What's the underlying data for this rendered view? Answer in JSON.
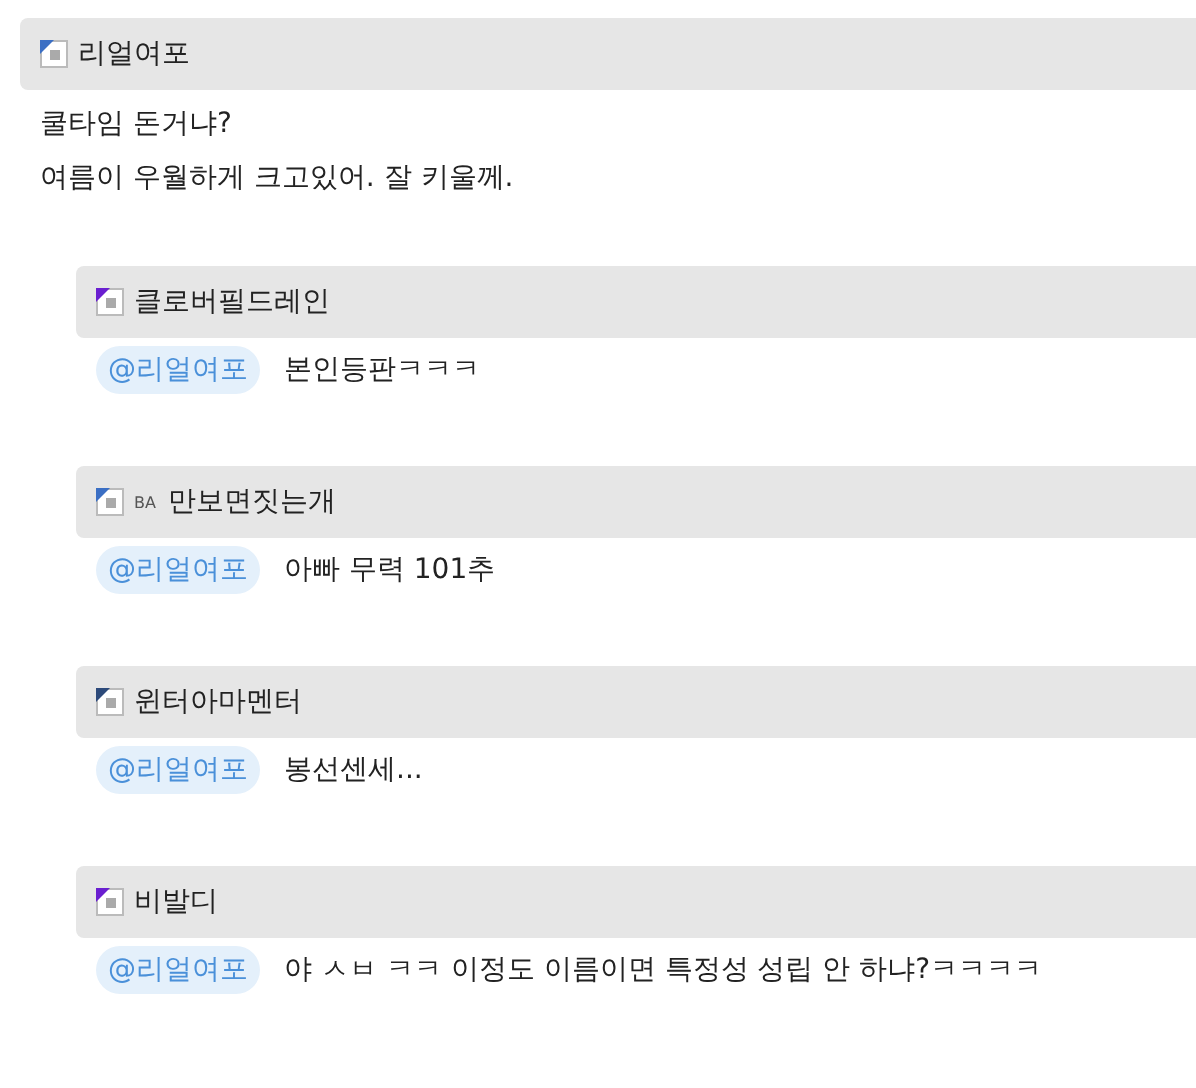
{
  "post": {
    "author": {
      "name": "리얼여포",
      "color": "#3b6fc4"
    },
    "lines": [
      "쿨타임 돈거냐?",
      "여름이 우월하게 크고있어. 잘 키울께."
    ]
  },
  "replies": [
    {
      "author": {
        "name": "클로버필드레인",
        "color": "#6a1fd0"
      },
      "mention": "@리얼여포",
      "text": "본인등판ㅋㅋㅋ"
    },
    {
      "author": {
        "name": "만보면짓는개",
        "prefix": "BA",
        "color": "#3b6fc4"
      },
      "mention": "@리얼여포",
      "text": "아빠 무력 101추"
    },
    {
      "author": {
        "name": "윈터아마멘터",
        "color": "#2d4a7a"
      },
      "mention": "@리얼여포",
      "text": "봉선센세..."
    },
    {
      "author": {
        "name": "비발디",
        "color": "#6a1fd0"
      },
      "mention": "@리얼여포",
      "text": "야 ㅅㅂ ㅋㅋ 이정도 이름이면 특정성 성립 안 하냐?ㅋㅋㅋㅋ"
    }
  ]
}
